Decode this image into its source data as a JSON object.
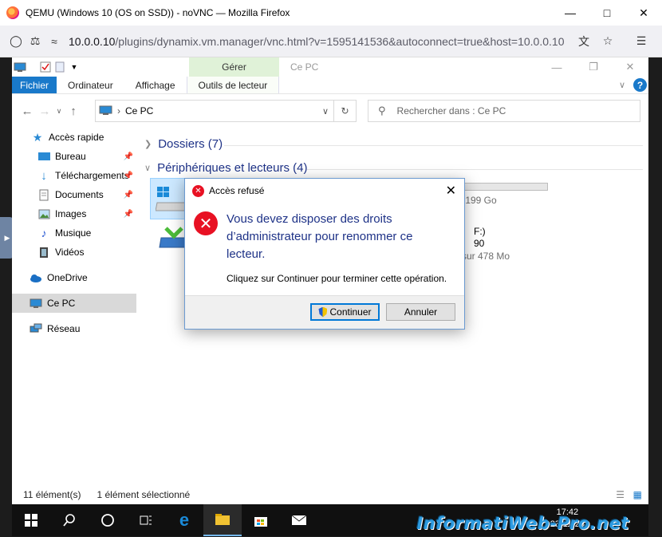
{
  "browser": {
    "title": "QEMU (Windows 10 (OS on SSD)) - noVNC — Mozilla Firefox",
    "url_host": "10.0.0.10",
    "url_rest": "/plugins/dynamix.vm.manager/vnc.html?v=1595141536&autoconnect=true&host=10.0.0.10"
  },
  "explorer": {
    "window_title": "Ce PC",
    "context_tab": "Gérer",
    "ribbon_tabs": [
      "Fichier",
      "Ordinateur",
      "Affichage",
      "Outils de lecteur"
    ],
    "address": "Ce PC",
    "search_placeholder": "Rechercher dans : Ce PC",
    "sidebar": {
      "quick_access": "Accès rapide",
      "bureau": "Bureau",
      "telechargements": "Téléchargements",
      "documents": "Documents",
      "images": "Images",
      "musique": "Musique",
      "videos": "Vidéos",
      "onedrive": "OneDrive",
      "cepc": "Ce PC",
      "reseau": "Réseau"
    },
    "groups": {
      "dossiers": "Dossiers (7)",
      "peripheriques": "Périphériques et lecteurs (4)"
    },
    "drives": {
      "c_free": "r 199 Go",
      "f_label": "F:)",
      "f_sub": "90",
      "f_free": "sur 478 Mo"
    },
    "status": {
      "count": "11 élément(s)",
      "selected": "1 élément sélectionné"
    }
  },
  "dialog": {
    "title": "Accès refusé",
    "message": "Vous devez disposer des droits d’administrateur pour renommer ce lecteur.",
    "sub": "Cliquez sur Continuer pour terminer cette opération.",
    "continue_label": "Continuer",
    "cancel_label": "Annuler"
  },
  "taskbar": {
    "time": "17:42",
    "date": "23-11-23"
  },
  "watermark": "InformatiWeb-Pro.net",
  "colors": {
    "accent": "#1979ca",
    "error": "#e81123",
    "heading_blue": "#1e3287",
    "gerer_green": "#e0f2d8"
  }
}
